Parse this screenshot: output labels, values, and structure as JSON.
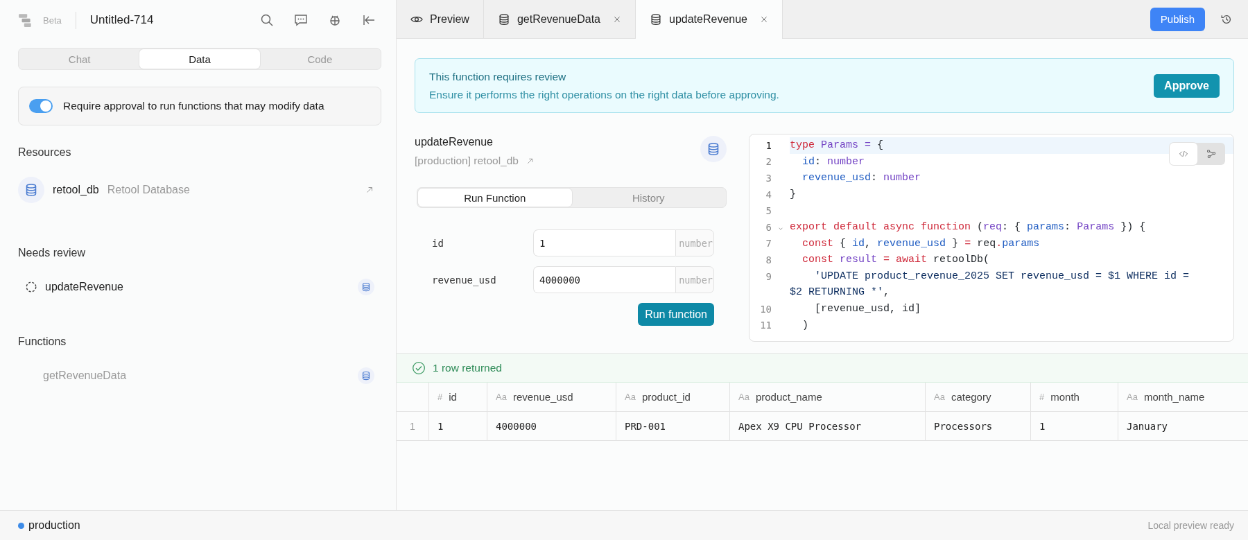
{
  "sidebar": {
    "badge": "Beta",
    "title": "Untitled-714",
    "tabs": [
      {
        "label": "Chat",
        "selected": false
      },
      {
        "label": "Data",
        "selected": true
      },
      {
        "label": "Code",
        "selected": false
      }
    ],
    "approval_toggle": {
      "on": true,
      "label": "Require approval to run functions that may modify data"
    },
    "sections": [
      {
        "heading": "Resources",
        "items": [
          {
            "kind": "resource",
            "name": "retool_db",
            "detail": "Retool Database"
          }
        ]
      },
      {
        "heading": "Needs review",
        "items": [
          {
            "kind": "pending",
            "name": "updateRevenue"
          }
        ]
      },
      {
        "heading": "Functions",
        "items": [
          {
            "kind": "function",
            "name": "getRevenueData"
          }
        ]
      }
    ]
  },
  "editor_tabs": [
    {
      "kind": "preview",
      "label": "Preview",
      "selected": false
    },
    {
      "kind": "function",
      "label": "getRevenueData",
      "selected": false
    },
    {
      "kind": "function",
      "label": "updateRevenue",
      "selected": true
    }
  ],
  "publish_button": "Publish",
  "review_banner": {
    "title": "This function requires review",
    "message": "Ensure it performs the right operations on the right data before approving.",
    "button": "Approve"
  },
  "function": {
    "name": "updateRevenue",
    "resource": "[production] retool_db",
    "tabs": [
      {
        "label": "Run Function",
        "selected": true
      },
      {
        "label": "History",
        "selected": false
      }
    ],
    "params": [
      {
        "name": "id",
        "value": "1",
        "type": "number"
      },
      {
        "name": "revenue_usd",
        "value": "4000000",
        "type": "number"
      }
    ],
    "run_button": "Run function"
  },
  "code": {
    "view_modes": [
      {
        "kind": "code",
        "selected": true
      },
      {
        "kind": "graph",
        "selected": false
      }
    ],
    "lines": [
      {
        "number": "1",
        "active": true,
        "foldable": false,
        "tokens": [
          {
            "kind": "keyword",
            "text": "type"
          },
          {
            "kind": "type",
            "text": " Params ="
          },
          {
            "kind": "plain",
            "text": " {"
          }
        ]
      },
      {
        "number": "2",
        "active": false,
        "foldable": false,
        "tokens": [
          {
            "kind": "prop",
            "text": "  id"
          },
          {
            "kind": "plain",
            "text": ": "
          },
          {
            "kind": "type",
            "text": "number"
          }
        ]
      },
      {
        "number": "3",
        "active": false,
        "foldable": false,
        "tokens": [
          {
            "kind": "prop",
            "text": "  revenue_usd"
          },
          {
            "kind": "plain",
            "text": ": "
          },
          {
            "kind": "type",
            "text": "number"
          }
        ]
      },
      {
        "number": "4",
        "active": false,
        "foldable": false,
        "tokens": [
          {
            "kind": "plain",
            "text": "}"
          }
        ]
      },
      {
        "number": "5",
        "active": false,
        "foldable": false
      },
      {
        "number": "6",
        "active": false,
        "foldable": true,
        "tokens": [
          {
            "kind": "keyword",
            "text": "export default async function"
          },
          {
            "kind": "plain",
            "text": " ("
          },
          {
            "kind": "type",
            "text": "req"
          },
          {
            "kind": "plain",
            "text": ": { "
          },
          {
            "kind": "prop",
            "text": "params"
          },
          {
            "kind": "plain",
            "text": ": "
          },
          {
            "kind": "type",
            "text": "Params"
          },
          {
            "kind": "plain",
            "text": " }) {"
          }
        ]
      },
      {
        "number": "7",
        "active": false,
        "foldable": false,
        "tokens": [
          {
            "kind": "keyword",
            "text": "  const"
          },
          {
            "kind": "plain",
            "text": " { "
          },
          {
            "kind": "prop",
            "text": "id"
          },
          {
            "kind": "plain",
            "text": ", "
          },
          {
            "kind": "prop",
            "text": "revenue_usd"
          },
          {
            "kind": "plain",
            "text": " } "
          },
          {
            "kind": "keyword",
            "text": "="
          },
          {
            "kind": "plain",
            "text": " req"
          },
          {
            "kind": "keyword",
            "text": "."
          },
          {
            "kind": "prop",
            "text": "params"
          }
        ]
      },
      {
        "number": "8",
        "active": false,
        "foldable": false,
        "tokens": [
          {
            "kind": "keyword",
            "text": "  const"
          },
          {
            "kind": "type",
            "text": " result"
          },
          {
            "kind": "keyword",
            "text": " = await"
          },
          {
            "kind": "plain",
            "text": " retoolDb("
          }
        ]
      },
      {
        "number": "9",
        "active": false,
        "foldable": false,
        "tokens": [
          {
            "kind": "string",
            "text": "    'UPDATE product_revenue_2025 SET revenue_usd = $1 WHERE id = $2 RETURNING *'"
          },
          {
            "kind": "plain",
            "text": ","
          }
        ]
      },
      {
        "number": "10",
        "active": false,
        "foldable": false,
        "tokens": [
          {
            "kind": "plain",
            "text": "    [revenue_usd, id]"
          }
        ]
      },
      {
        "number": "11",
        "active": false,
        "foldable": false,
        "tokens": [
          {
            "kind": "plain",
            "text": "  )"
          }
        ]
      }
    ]
  },
  "results": {
    "status": "1 row returned",
    "columns": [
      {
        "type_mark": "#",
        "label": "id"
      },
      {
        "type_mark": "Aa",
        "label": "revenue_usd"
      },
      {
        "type_mark": "Aa",
        "label": "product_id"
      },
      {
        "type_mark": "Aa",
        "label": "product_name"
      },
      {
        "type_mark": "Aa",
        "label": "category"
      },
      {
        "type_mark": "#",
        "label": "month"
      },
      {
        "type_mark": "Aa",
        "label": "month_name"
      }
    ],
    "rows": [
      {
        "number": "1",
        "cells": [
          "1",
          "4000000",
          "PRD-001",
          "Apex X9 CPU Processor",
          "Processors",
          "1",
          "January"
        ]
      }
    ]
  },
  "status_bar": {
    "environment": "production",
    "message": "Local preview ready"
  }
}
